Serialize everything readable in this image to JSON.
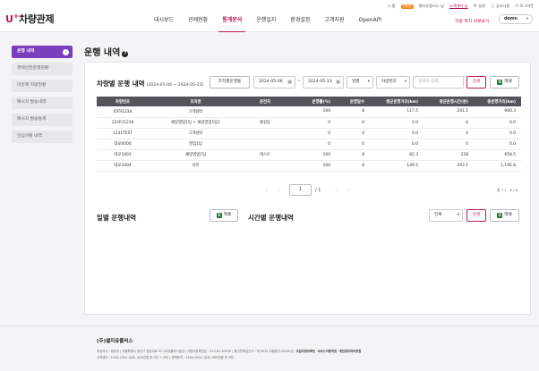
{
  "utility": {
    "home": "홈",
    "badge": "관리자",
    "user_prefix": "엘지유플러스 님",
    "company": "고객센터 님",
    "settings": "설정",
    "notice": "공지사항",
    "logout": "로그아웃"
  },
  "header": {
    "logo_u": "U",
    "logo_plus": "+",
    "logo_rest": "차량관제",
    "nav": [
      "대시보드",
      "관제현황",
      "통계분석",
      "운행일지",
      "환경설정",
      "고객지원",
      "OpenAPI"
    ],
    "active_nav": "통계분석",
    "shortcut": "차량 위치 바로보기",
    "user_select": "demo"
  },
  "sidebar": {
    "items": [
      {
        "label": "운행 내역",
        "active": true
      },
      {
        "label": "경제안전운행현황",
        "active": false
      },
      {
        "label": "미관제 차량현황",
        "active": false
      },
      {
        "label": "메시지 발송내역",
        "active": false
      },
      {
        "label": "메시지 발송통계",
        "active": false
      },
      {
        "label": "안심이탈 내역",
        "active": false
      }
    ],
    "active_arrow": "›"
  },
  "page": {
    "title": "운행 내역",
    "help": "?"
  },
  "driving": {
    "title": "차량별 운행 내역",
    "period": "(2024-05-06 ~ 2024-05-13)",
    "org_button": "조직별운행통",
    "date_from": "2024-05-06",
    "date_sep": "~",
    "date_to": "2024-05-13",
    "range_select": "일별",
    "type_select": "차량번호",
    "search_placeholder": "검색어 입력",
    "search_button": "검색",
    "excel_button": "엑셀",
    "excel_icon": "X",
    "columns": [
      "차량번호",
      "조직명",
      "운전자",
      "운행률(%)",
      "운행일수",
      "평균운행거리(km)",
      "평균운행시간(분)",
      "총운행거리(km)"
    ],
    "rows": [
      [
        "05허1234",
        "고객센터",
        "",
        "100",
        "8",
        "117.5",
        "241.1",
        "940.3"
      ],
      [
        "12서다1234",
        "채널영업1팀 > 채널영업1팀1",
        "홍길동",
        "0",
        "0",
        "0.0",
        "0",
        "0.0"
      ],
      [
        "1231TEST",
        "고객센터",
        "",
        "0",
        "0",
        "0.0",
        "0",
        "0.0"
      ],
      [
        "데모0000",
        "영업1팀",
        "",
        "0",
        "0",
        "0.0",
        "0",
        "0.0"
      ],
      [
        "데모1003",
        "채널영업1팀",
        "테스트",
        "100",
        "8",
        "82.3",
        "238",
        "658.5"
      ],
      [
        "데모1004",
        "라마",
        "",
        "100",
        "8",
        "149.5",
        "293.1",
        "1,195.8"
      ]
    ],
    "pager": {
      "first": "«",
      "prev": "‹",
      "page": "1",
      "total": "/ 1",
      "next": "›",
      "last": "»",
      "summary": "총 7 1 - 6 / 6"
    }
  },
  "daily": {
    "title": "일별 운행내역",
    "excel_button": "엑셀"
  },
  "hourly": {
    "title": "시간별 운행내역",
    "select": "전체",
    "search_button": "검색",
    "excel_button": "엑셀"
  },
  "footer": {
    "company": "(주)엘지유플러스",
    "line1": "대표이사 : 황현식 | 서울특별시 용산구 한강대로 32 LG유플러스빌딩 | 사업자등록번호 : 220-81-39938 | 통신판매업신고 : 제 2015-서울용산-00481호",
    "link1": "사업자정보확인",
    "link2": "서비스이용약관",
    "link3": "개인정보처리방침",
    "line2": "고객센터 : 1544-2500 (유료, ARS연결 후 0번 → 2번) | 장애문의 : 1544-0001 (유료, ARS연결 후 5번)"
  }
}
